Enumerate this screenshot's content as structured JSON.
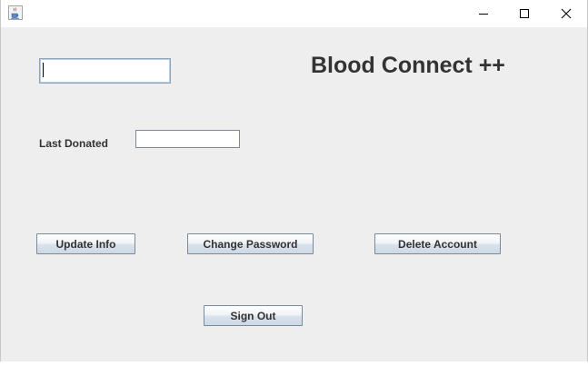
{
  "window": {
    "title": "",
    "controls": {
      "minimize": "minimize-icon",
      "maximize": "maximize-icon",
      "close": "close-icon"
    },
    "app_icon": "java-coffee-cup-icon"
  },
  "main": {
    "app_title": "Blood Connect ++",
    "name_field": {
      "value": "",
      "placeholder": ""
    },
    "last_donated": {
      "label": "Last Donated",
      "value": ""
    },
    "buttons": {
      "update_info": "Update Info",
      "change_password": "Change Password",
      "delete_account": "Delete Account",
      "sign_out": "Sign Out"
    }
  },
  "colors": {
    "background": "#eeeeee",
    "text": "#333333",
    "field_border": "#7a8a99"
  }
}
